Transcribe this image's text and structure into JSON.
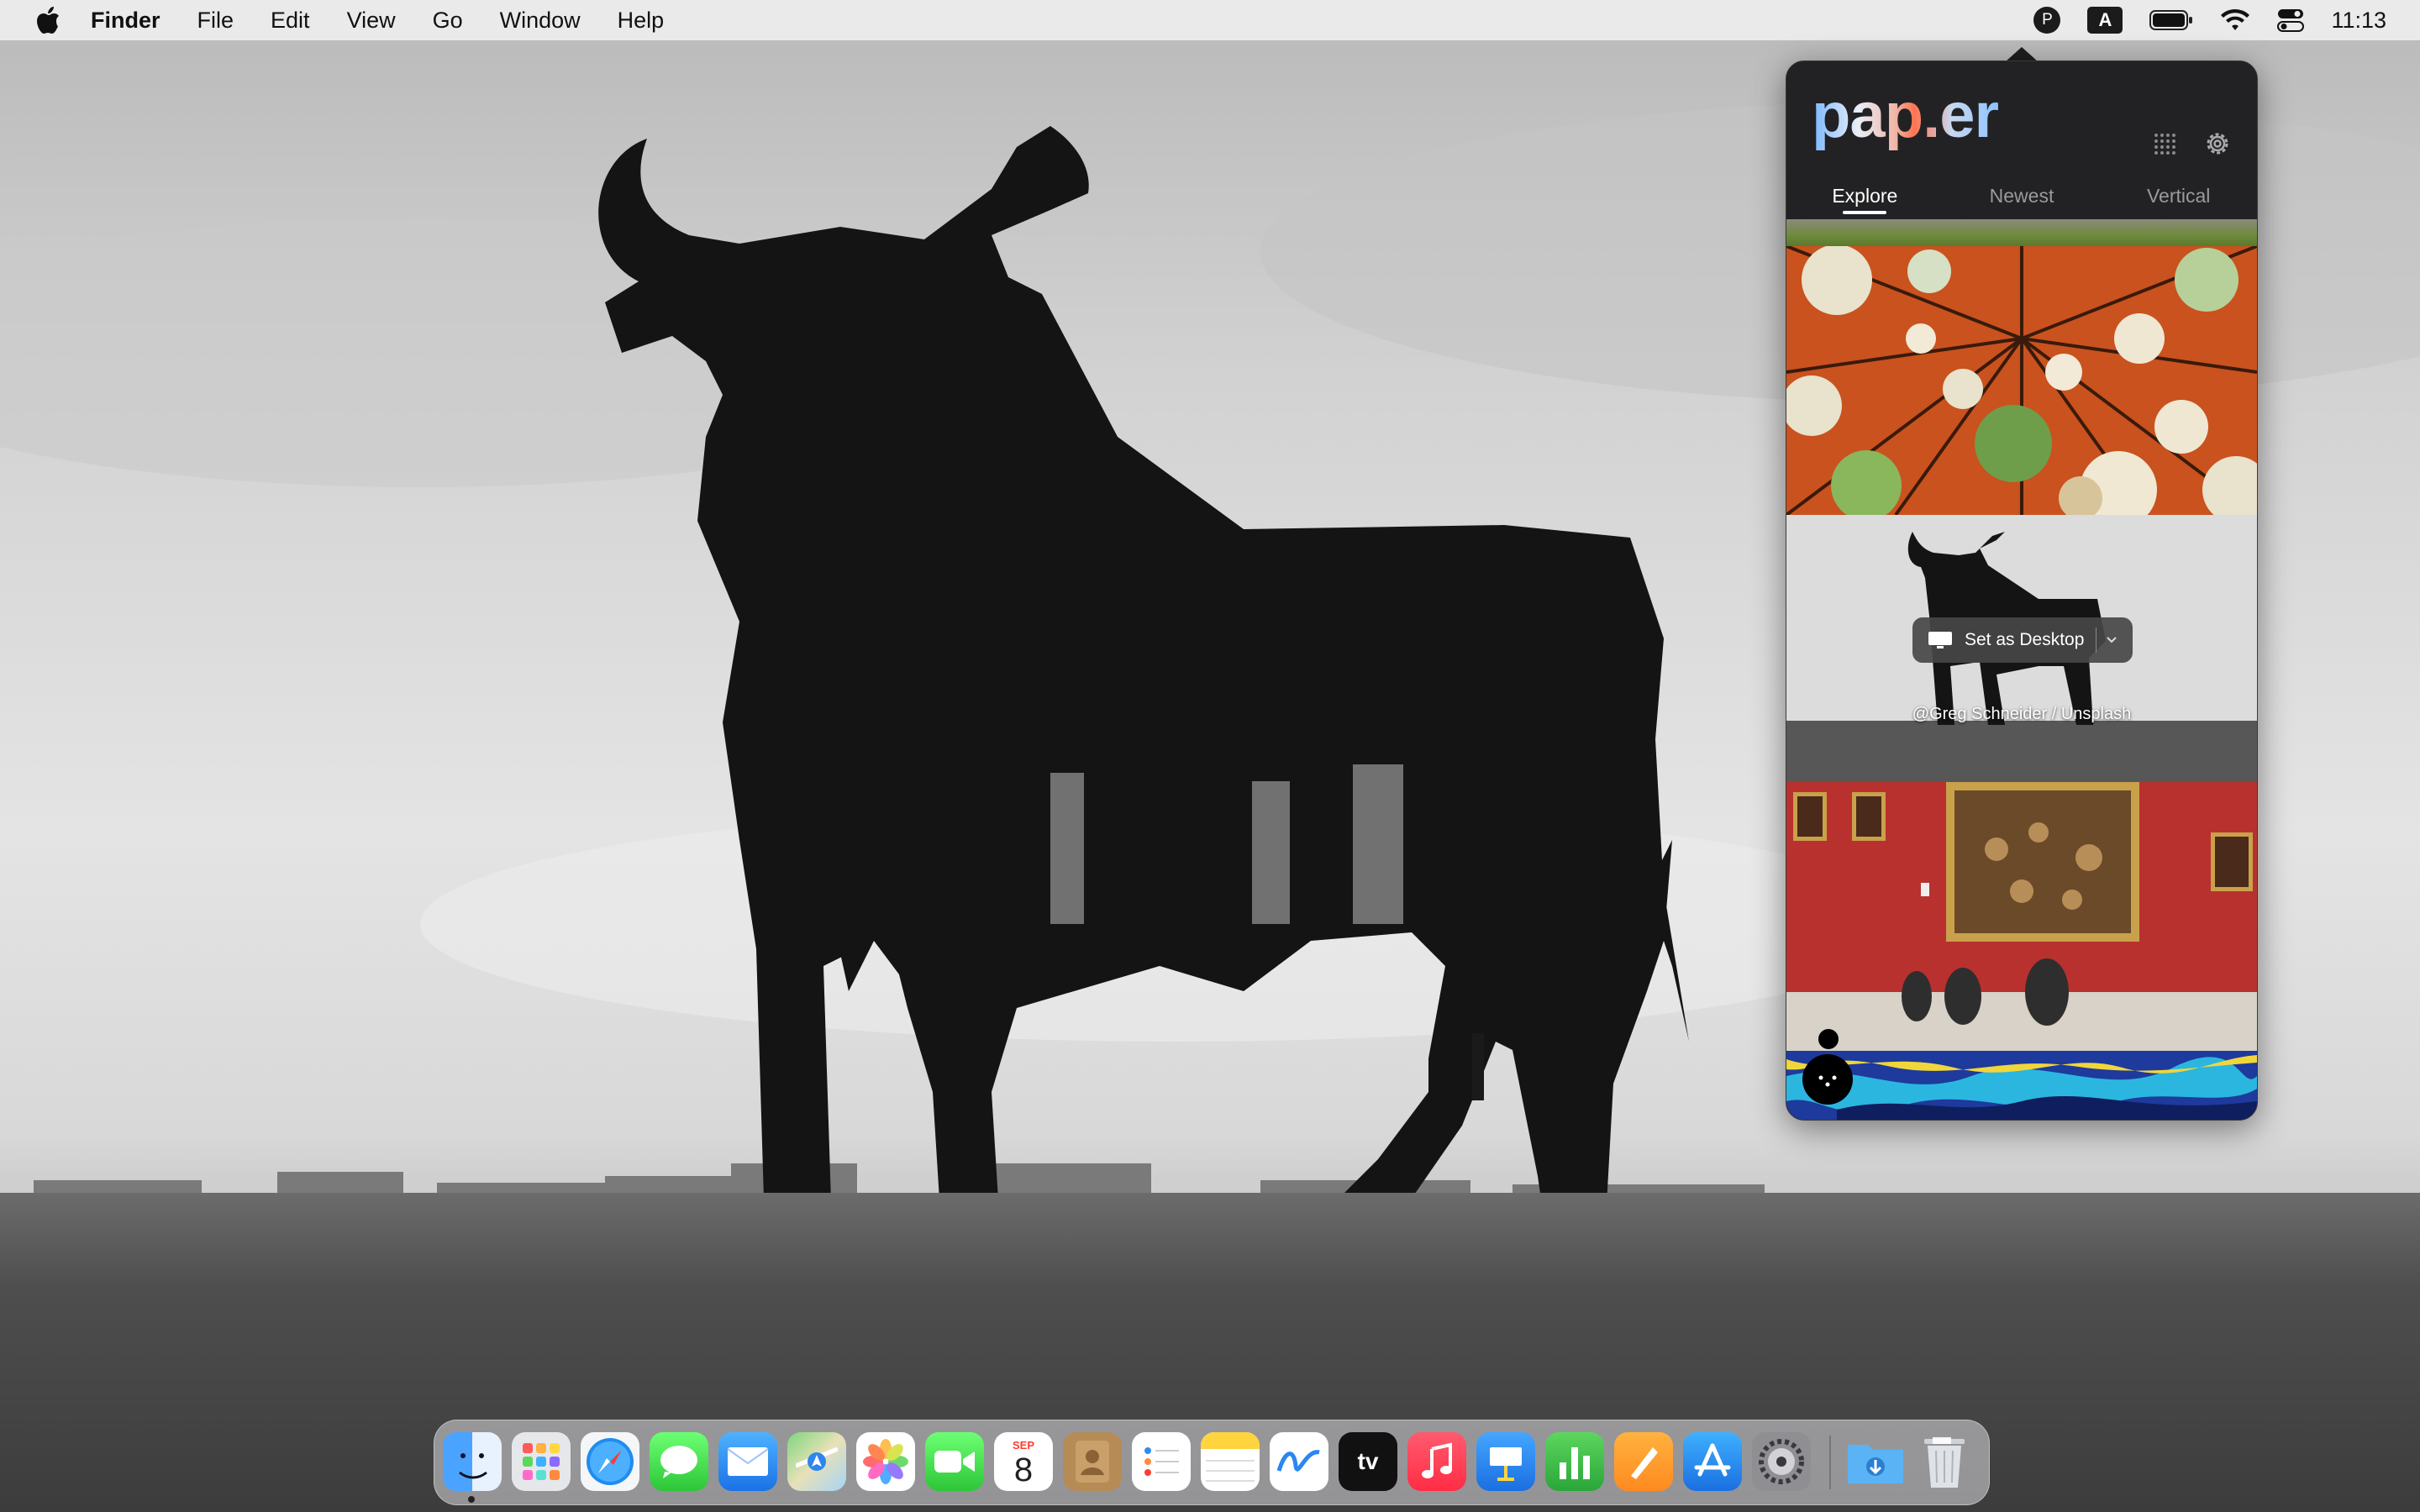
{
  "menubar": {
    "app_name": "Finder",
    "menus": [
      "File",
      "Edit",
      "View",
      "Go",
      "Window",
      "Help"
    ],
    "status_icons": [
      "paper-app-icon",
      "input-source-icon",
      "battery-icon",
      "wifi-icon",
      "control-center-icon"
    ],
    "input_source_label": "A",
    "paper_icon_label": "P",
    "clock": "11:13"
  },
  "popover": {
    "logo": "pap.er",
    "tabs": [
      {
        "label": "Explore",
        "active": true
      },
      {
        "label": "Newest",
        "active": false
      },
      {
        "label": "Vertical",
        "active": false
      }
    ],
    "hover_card": {
      "set_desktop_label": "Set as Desktop",
      "credit": "@Greg Schneider / Unsplash"
    }
  },
  "dock": {
    "apps": [
      "Finder",
      "Launchpad",
      "Safari",
      "Messages",
      "Mail",
      "Maps",
      "Photos",
      "FaceTime",
      "Calendar",
      "Contacts",
      "Reminders",
      "Notes",
      "Freeform",
      "TV",
      "Music",
      "Keynote",
      "Numbers",
      "Pages",
      "App Store",
      "System Settings"
    ],
    "calendar": {
      "month": "SEP",
      "day": "8"
    },
    "tv_label": "tv",
    "stacks": [
      "Downloads",
      "Trash"
    ]
  },
  "colors": {
    "accent_red": "#ff3b30",
    "popover_bg": "#1e1e1f",
    "tab_active": "#ffffff",
    "tab_inactive": "#9a9a9a"
  }
}
